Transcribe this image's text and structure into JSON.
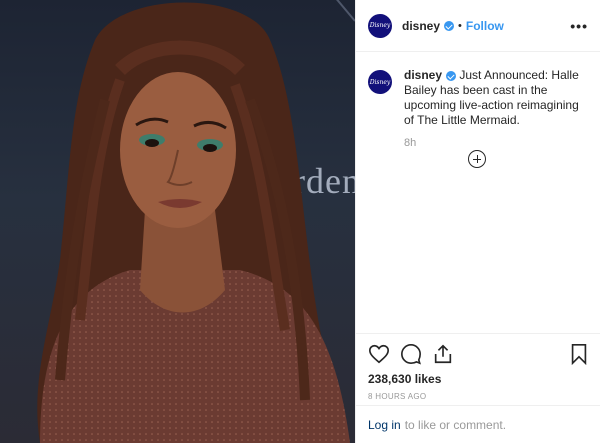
{
  "header": {
    "avatar_text": "Disney",
    "username": "disney",
    "separator": "•",
    "follow_label": "Follow",
    "more_label": "•••"
  },
  "caption": {
    "username": "disney",
    "text": "Just Announced: Halle Bailey has been cast in the upcoming live-action reimagining of The Little Mermaid.",
    "time": "8h"
  },
  "photo": {
    "backdrop_text": "Arden"
  },
  "actions": {
    "likes": "238,630 likes",
    "posted_ago": "8 HOURS AGO"
  },
  "login": {
    "link_label": "Log in",
    "text": "to like or comment."
  },
  "colors": {
    "accent": "#3897f0",
    "avatar_bg": "#12107a",
    "link": "#003569"
  }
}
